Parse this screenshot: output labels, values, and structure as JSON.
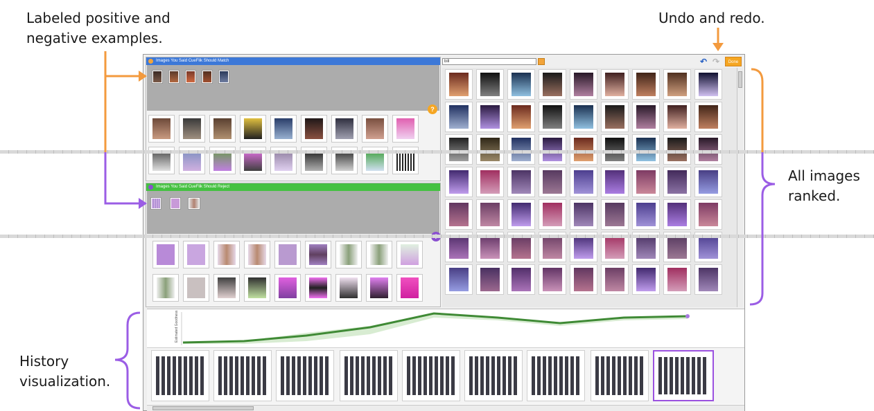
{
  "callouts": {
    "labeled_examples": [
      "Labeled positive and",
      "negative examples."
    ],
    "undo_redo": "Undo and redo.",
    "all_ranked": [
      "All images",
      "ranked."
    ],
    "history": [
      "History",
      "visualization."
    ]
  },
  "app": {
    "watch_panel": {
      "title": "Images You Said CueFlik Should Match",
      "header_color": "#3c78d8"
    },
    "reject_panel": {
      "title": "Images You Said CueFlik Should Reject",
      "header_color": "#45c141"
    },
    "search": {
      "value": "bill"
    },
    "toolbar": {
      "undo_icon": "undo-icon",
      "redo_icon": "redo-icon",
      "done_label": "Done"
    },
    "help_badge": "?",
    "history_axis_label": "Estimated Goodness",
    "history_ticks": [
      "0",
      "1",
      "2",
      "3",
      "4",
      "5",
      "6",
      "7",
      "8"
    ]
  },
  "colors": {
    "accent": "#f5a623",
    "purple": "#9b51e0",
    "orange_callout": "#f39a3e",
    "purple_callout": "#9b5de5",
    "line": "#3f8a35"
  }
}
